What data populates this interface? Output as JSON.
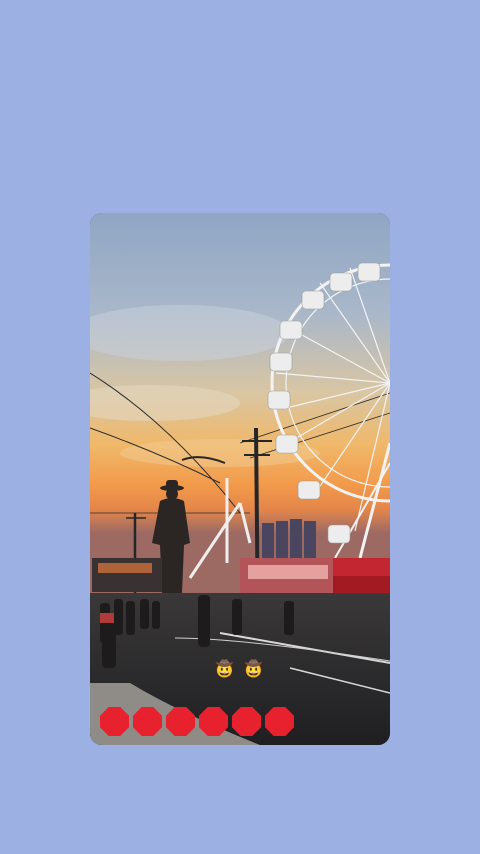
{
  "story": {
    "emoji_caption": "🤠 🤠",
    "stickers": [
      {
        "label": ""
      },
      {
        "label": ""
      },
      {
        "label": ""
      },
      {
        "label": ""
      },
      {
        "label": ""
      },
      {
        "label": ""
      }
    ]
  },
  "colors": {
    "background": "#9db0e3",
    "sticker": "#e8212f"
  }
}
